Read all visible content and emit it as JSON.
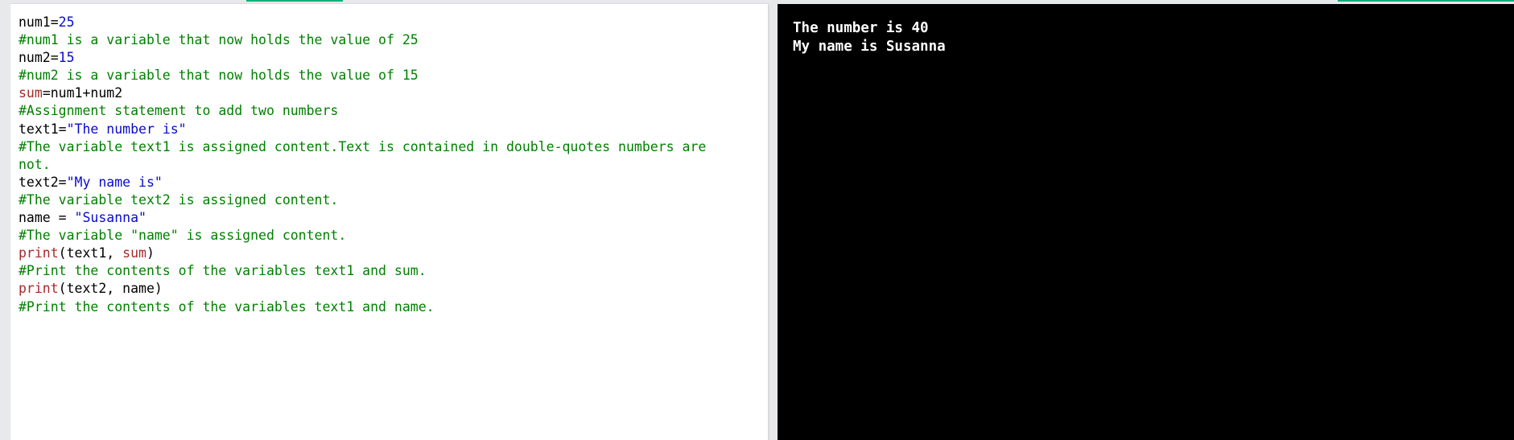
{
  "colors": {
    "comment": "#008000",
    "literal": "#0a0acd",
    "builtin": "#a52a2a",
    "console_bg": "#000000",
    "accent": "#10b07a"
  },
  "editor": {
    "lines": [
      [
        {
          "t": "num1=",
          "c": ""
        },
        {
          "t": "25",
          "c": "n"
        }
      ],
      [
        {
          "t": "#num1 is a variable that now holds the value of 25",
          "c": "c"
        }
      ],
      [
        {
          "t": "num2=",
          "c": ""
        },
        {
          "t": "15",
          "c": "n"
        }
      ],
      [
        {
          "t": "#num2 is a variable that now holds the value of 15",
          "c": "c"
        }
      ],
      [
        {
          "t": "sum",
          "c": "k"
        },
        {
          "t": "=num1+num2",
          "c": ""
        }
      ],
      [
        {
          "t": "#Assignment statement to add two numbers",
          "c": "c"
        }
      ],
      [
        {
          "t": "text1=",
          "c": ""
        },
        {
          "t": "\"The number is\"",
          "c": "s"
        }
      ],
      [
        {
          "t": "#The variable text1 is assigned content.Text is contained in double-quotes numbers are",
          "c": "c"
        }
      ],
      [
        {
          "t": "not.",
          "c": "c"
        }
      ],
      [
        {
          "t": "text2=",
          "c": ""
        },
        {
          "t": "\"My name is\"",
          "c": "s"
        }
      ],
      [
        {
          "t": "#The variable text2 is assigned content.",
          "c": "c"
        }
      ],
      [
        {
          "t": "name = ",
          "c": ""
        },
        {
          "t": "\"Susanna\"",
          "c": "s"
        }
      ],
      [
        {
          "t": "#The variable \"name\" is assigned content.",
          "c": "c"
        }
      ],
      [
        {
          "t": "print",
          "c": "k"
        },
        {
          "t": "(text1, ",
          "c": ""
        },
        {
          "t": "sum",
          "c": "k"
        },
        {
          "t": ")",
          "c": ""
        }
      ],
      [
        {
          "t": "#Print the contents of the variables text1 and sum.",
          "c": "c"
        }
      ],
      [
        {
          "t": "print",
          "c": "k"
        },
        {
          "t": "(text2, name)",
          "c": ""
        }
      ],
      [
        {
          "t": "#Print the contents of the variables text1 and name.",
          "c": "c"
        }
      ]
    ]
  },
  "console": {
    "lines": [
      "The number is 40",
      "My name is Susanna"
    ]
  }
}
